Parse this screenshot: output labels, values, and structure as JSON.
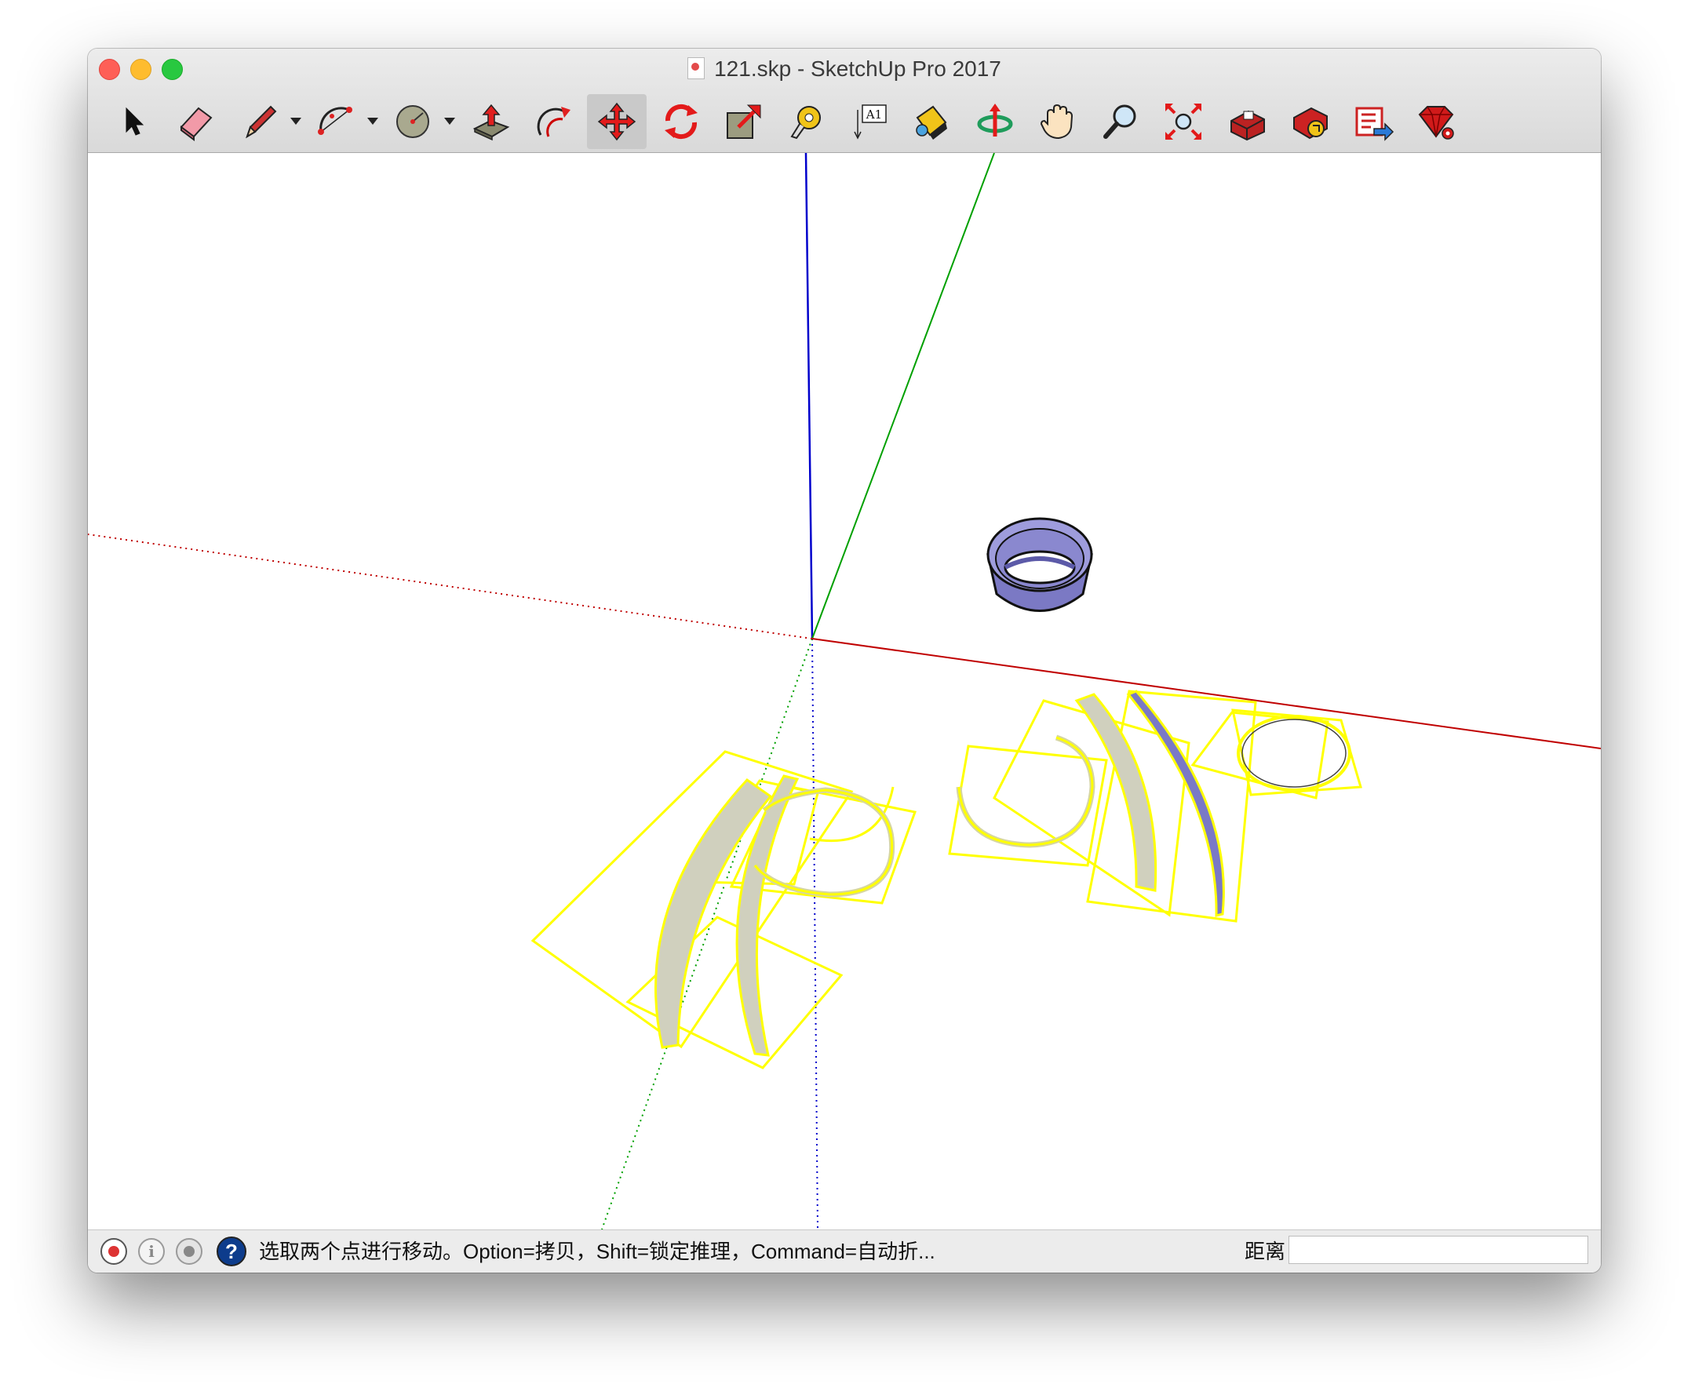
{
  "window": {
    "title": "121.skp - SketchUp Pro 2017"
  },
  "toolbar": {
    "tools": [
      {
        "name": "select",
        "icon": "arrow-cursor-icon"
      },
      {
        "name": "eraser",
        "icon": "eraser-icon"
      },
      {
        "name": "line",
        "icon": "pencil-icon",
        "has_dropdown": true
      },
      {
        "name": "arc",
        "icon": "arc-icon",
        "has_dropdown": true
      },
      {
        "name": "shapes",
        "icon": "circle-shape-icon",
        "has_dropdown": true
      },
      {
        "name": "push-pull",
        "icon": "push-pull-icon"
      },
      {
        "name": "offset",
        "icon": "offset-icon"
      },
      {
        "name": "move",
        "icon": "move-icon",
        "active": true
      },
      {
        "name": "rotate",
        "icon": "rotate-icon"
      },
      {
        "name": "scale",
        "icon": "scale-icon"
      },
      {
        "name": "tape-measure",
        "icon": "tape-measure-icon"
      },
      {
        "name": "text",
        "icon": "text-label-icon",
        "label": "A1"
      },
      {
        "name": "paint-bucket",
        "icon": "paint-bucket-icon"
      },
      {
        "name": "orbit",
        "icon": "orbit-icon"
      },
      {
        "name": "pan",
        "icon": "hand-icon"
      },
      {
        "name": "zoom",
        "icon": "magnifier-icon"
      },
      {
        "name": "zoom-extents",
        "icon": "zoom-extents-icon"
      },
      {
        "name": "3d-warehouse",
        "icon": "warehouse-icon"
      },
      {
        "name": "share-model",
        "icon": "share-model-icon"
      },
      {
        "name": "extension-warehouse",
        "icon": "extension-warehouse-icon"
      },
      {
        "name": "ruby-console",
        "icon": "ruby-gem-icon"
      }
    ]
  },
  "colors": {
    "axis_blue": "#0000cc",
    "axis_green": "#00a000",
    "axis_red": "#c00000",
    "selection_yellow": "#ffff00",
    "face_gray": "#cfcfbf",
    "face_purple": "#7a79c6"
  },
  "statusbar": {
    "hint": "选取两个点进行移动。Option=拷贝，Shift=锁定推理，Command=自动折...",
    "help_symbol": "?",
    "info_symbol": "i",
    "measure_label": "距离",
    "measure_value": ""
  }
}
